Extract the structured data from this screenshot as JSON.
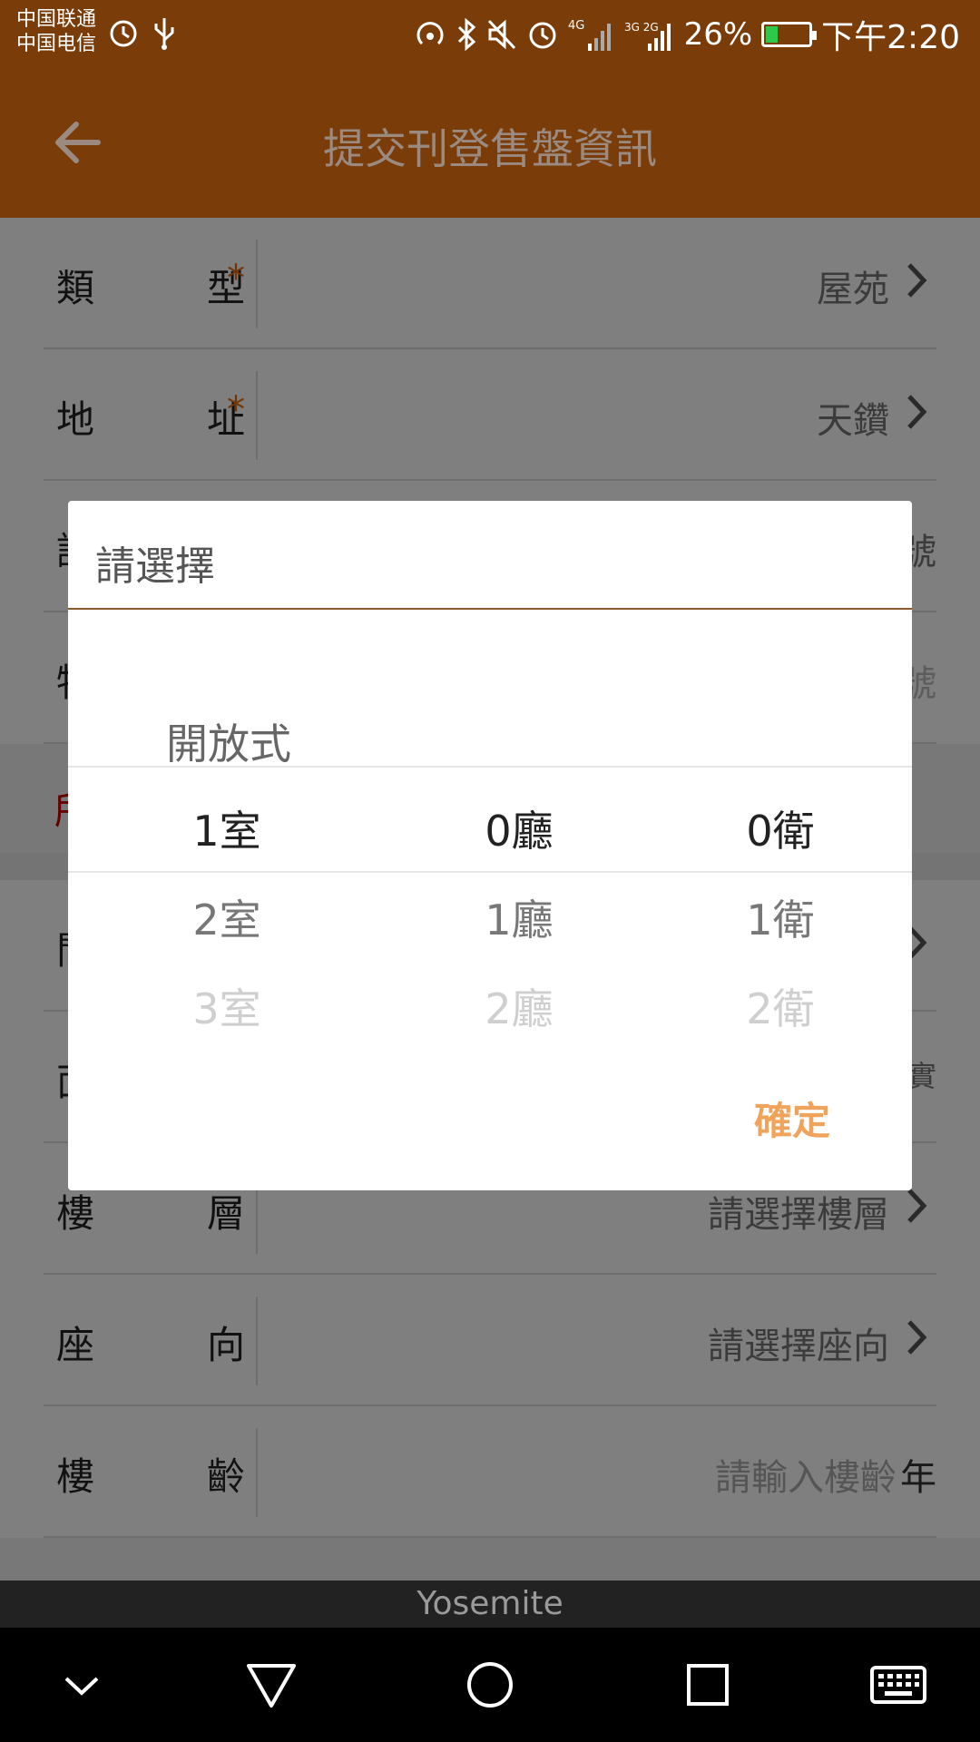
{
  "status_bar": {
    "carrier_1": "中国联通",
    "carrier_2": "中国电信",
    "signal_1_label": "4G",
    "signal_2_label": "3G 2G",
    "battery_percent": "26%",
    "battery_level": 0.26,
    "time": "下午2:20"
  },
  "header": {
    "title": "提交刊登售盤資訊"
  },
  "form": {
    "rows": [
      {
        "label_1": "類",
        "label_2": "型",
        "required": "*",
        "value": "屋苑"
      },
      {
        "label_1": "地",
        "label_2": "址",
        "required": "*",
        "value": "天鑽"
      },
      {
        "label_1": "請",
        "edge_value": "號"
      },
      {
        "label_1": "物",
        "edge_value": "號"
      },
      {
        "label_1": "問"
      },
      {
        "label_1": "面",
        "edge_value": "實"
      },
      {
        "label_1": "樓",
        "label_2": "層",
        "placeholder": "請選擇樓層"
      },
      {
        "label_1": "座",
        "label_2": "向",
        "placeholder": "請選擇座向"
      },
      {
        "label_1": "樓",
        "label_2": "齡",
        "placeholder": "請輸入樓齡",
        "unit": "年"
      }
    ],
    "warning_stub": "所"
  },
  "dialog": {
    "title": "請選擇",
    "option_above": "開放式",
    "columns": [
      {
        "selected": "1室",
        "next": "2室",
        "far": "3室"
      },
      {
        "selected": "0廳",
        "next": "1廳",
        "far": "2廳"
      },
      {
        "selected": "0衛",
        "next": "1衛",
        "far": "2衛"
      }
    ],
    "confirm_label": "確定",
    "accent_color": "#f0a35a"
  },
  "ime_bar": {
    "label": "Yosemite"
  },
  "nav_bar": {
    "icons": [
      "chevron-down-icon",
      "back-triangle-icon",
      "home-circle-icon",
      "recents-square-icon",
      "keyboard-icon"
    ]
  },
  "colors": {
    "header_brown": "#7a3c08",
    "required_orange": "#e06a10"
  }
}
